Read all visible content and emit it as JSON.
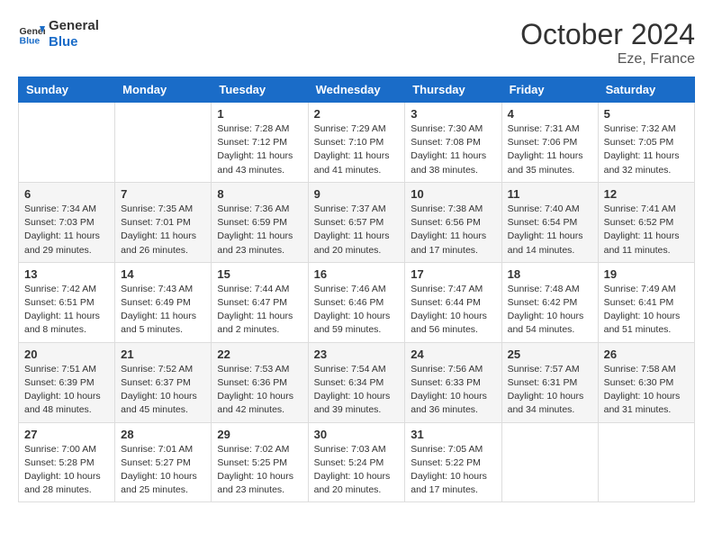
{
  "header": {
    "logo_general": "General",
    "logo_blue": "Blue",
    "month": "October 2024",
    "location": "Eze, France"
  },
  "weekdays": [
    "Sunday",
    "Monday",
    "Tuesday",
    "Wednesday",
    "Thursday",
    "Friday",
    "Saturday"
  ],
  "weeks": [
    [
      {
        "day": "",
        "info": ""
      },
      {
        "day": "",
        "info": ""
      },
      {
        "day": "1",
        "info": "Sunrise: 7:28 AM\nSunset: 7:12 PM\nDaylight: 11 hours and 43 minutes."
      },
      {
        "day": "2",
        "info": "Sunrise: 7:29 AM\nSunset: 7:10 PM\nDaylight: 11 hours and 41 minutes."
      },
      {
        "day": "3",
        "info": "Sunrise: 7:30 AM\nSunset: 7:08 PM\nDaylight: 11 hours and 38 minutes."
      },
      {
        "day": "4",
        "info": "Sunrise: 7:31 AM\nSunset: 7:06 PM\nDaylight: 11 hours and 35 minutes."
      },
      {
        "day": "5",
        "info": "Sunrise: 7:32 AM\nSunset: 7:05 PM\nDaylight: 11 hours and 32 minutes."
      }
    ],
    [
      {
        "day": "6",
        "info": "Sunrise: 7:34 AM\nSunset: 7:03 PM\nDaylight: 11 hours and 29 minutes."
      },
      {
        "day": "7",
        "info": "Sunrise: 7:35 AM\nSunset: 7:01 PM\nDaylight: 11 hours and 26 minutes."
      },
      {
        "day": "8",
        "info": "Sunrise: 7:36 AM\nSunset: 6:59 PM\nDaylight: 11 hours and 23 minutes."
      },
      {
        "day": "9",
        "info": "Sunrise: 7:37 AM\nSunset: 6:57 PM\nDaylight: 11 hours and 20 minutes."
      },
      {
        "day": "10",
        "info": "Sunrise: 7:38 AM\nSunset: 6:56 PM\nDaylight: 11 hours and 17 minutes."
      },
      {
        "day": "11",
        "info": "Sunrise: 7:40 AM\nSunset: 6:54 PM\nDaylight: 11 hours and 14 minutes."
      },
      {
        "day": "12",
        "info": "Sunrise: 7:41 AM\nSunset: 6:52 PM\nDaylight: 11 hours and 11 minutes."
      }
    ],
    [
      {
        "day": "13",
        "info": "Sunrise: 7:42 AM\nSunset: 6:51 PM\nDaylight: 11 hours and 8 minutes."
      },
      {
        "day": "14",
        "info": "Sunrise: 7:43 AM\nSunset: 6:49 PM\nDaylight: 11 hours and 5 minutes."
      },
      {
        "day": "15",
        "info": "Sunrise: 7:44 AM\nSunset: 6:47 PM\nDaylight: 11 hours and 2 minutes."
      },
      {
        "day": "16",
        "info": "Sunrise: 7:46 AM\nSunset: 6:46 PM\nDaylight: 10 hours and 59 minutes."
      },
      {
        "day": "17",
        "info": "Sunrise: 7:47 AM\nSunset: 6:44 PM\nDaylight: 10 hours and 56 minutes."
      },
      {
        "day": "18",
        "info": "Sunrise: 7:48 AM\nSunset: 6:42 PM\nDaylight: 10 hours and 54 minutes."
      },
      {
        "day": "19",
        "info": "Sunrise: 7:49 AM\nSunset: 6:41 PM\nDaylight: 10 hours and 51 minutes."
      }
    ],
    [
      {
        "day": "20",
        "info": "Sunrise: 7:51 AM\nSunset: 6:39 PM\nDaylight: 10 hours and 48 minutes."
      },
      {
        "day": "21",
        "info": "Sunrise: 7:52 AM\nSunset: 6:37 PM\nDaylight: 10 hours and 45 minutes."
      },
      {
        "day": "22",
        "info": "Sunrise: 7:53 AM\nSunset: 6:36 PM\nDaylight: 10 hours and 42 minutes."
      },
      {
        "day": "23",
        "info": "Sunrise: 7:54 AM\nSunset: 6:34 PM\nDaylight: 10 hours and 39 minutes."
      },
      {
        "day": "24",
        "info": "Sunrise: 7:56 AM\nSunset: 6:33 PM\nDaylight: 10 hours and 36 minutes."
      },
      {
        "day": "25",
        "info": "Sunrise: 7:57 AM\nSunset: 6:31 PM\nDaylight: 10 hours and 34 minutes."
      },
      {
        "day": "26",
        "info": "Sunrise: 7:58 AM\nSunset: 6:30 PM\nDaylight: 10 hours and 31 minutes."
      }
    ],
    [
      {
        "day": "27",
        "info": "Sunrise: 7:00 AM\nSunset: 5:28 PM\nDaylight: 10 hours and 28 minutes."
      },
      {
        "day": "28",
        "info": "Sunrise: 7:01 AM\nSunset: 5:27 PM\nDaylight: 10 hours and 25 minutes."
      },
      {
        "day": "29",
        "info": "Sunrise: 7:02 AM\nSunset: 5:25 PM\nDaylight: 10 hours and 23 minutes."
      },
      {
        "day": "30",
        "info": "Sunrise: 7:03 AM\nSunset: 5:24 PM\nDaylight: 10 hours and 20 minutes."
      },
      {
        "day": "31",
        "info": "Sunrise: 7:05 AM\nSunset: 5:22 PM\nDaylight: 10 hours and 17 minutes."
      },
      {
        "day": "",
        "info": ""
      },
      {
        "day": "",
        "info": ""
      }
    ]
  ]
}
